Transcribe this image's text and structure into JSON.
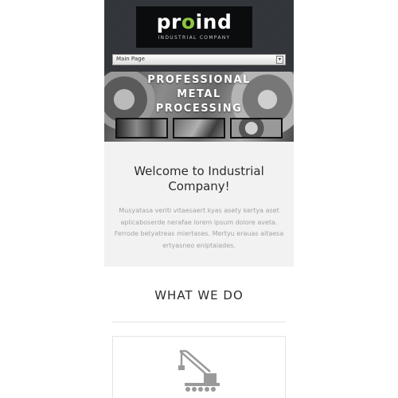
{
  "header": {
    "logo_text_pre": "pr",
    "logo_text_o": "o",
    "logo_text_post": "ind",
    "logo_subtitle": "INDUSTRIAL COMPANY",
    "logo_accent_color": "#8cc63f"
  },
  "nav": {
    "selected": "Main Page"
  },
  "slider": {
    "title_line1": "PROFESSIONAL",
    "title_line2": "METAL",
    "title_line3": "PROCESSING"
  },
  "welcome": {
    "title_line1": "Welcome to Industrial",
    "title_line2": "Company!",
    "text": "Musyatasa veriti vitaesaert kyas asety kertya aset aplicaboserde nerafae lorem ipsum dolore aveta. Ferrode betyatreas miertases. Mertyu erauas aitaesa ertyasneo eniptaiades."
  },
  "services": {
    "title": "WHAT WE DO",
    "card_icon": "crane-icon"
  }
}
